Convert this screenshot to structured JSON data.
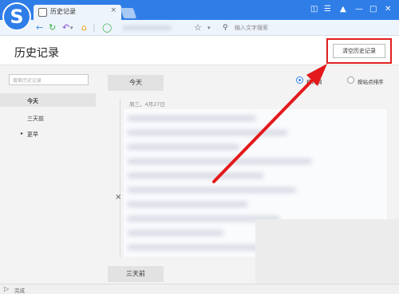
{
  "browser": {
    "logo_letter": "S",
    "tab_title": "历史记录",
    "tab_close": "×",
    "search_placeholder": "输入文字搜索"
  },
  "header": {
    "title": "历史记录",
    "clear_button": "清空历史记录"
  },
  "sidebar": {
    "search_placeholder": "搜索历史记录",
    "items": [
      {
        "label": "今天"
      },
      {
        "label": "三天前"
      },
      {
        "label": "更早",
        "expander": "▸"
      }
    ]
  },
  "main": {
    "group_today": "今天",
    "sort_by_time": "按时间",
    "sort_by_site": "按站点排序",
    "date_line": "周三，4月27日",
    "delete_mark": "×",
    "group_three_days": "三天前"
  },
  "status": {
    "text": "完成"
  },
  "colors": {
    "chrome_blue": "#2f7ee8",
    "highlight_red": "#e02020",
    "arrow_red": "#e3191b"
  }
}
